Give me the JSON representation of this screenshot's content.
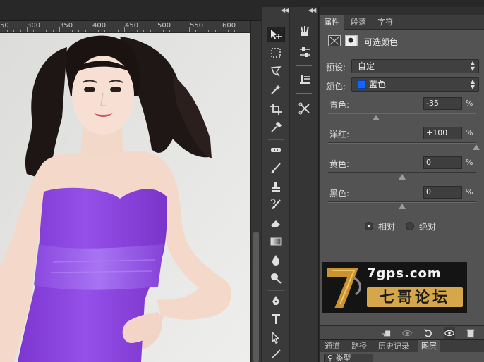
{
  "ruler": {
    "ticks": [
      "50",
      "300",
      "350",
      "400",
      "450",
      "500",
      "550",
      "600"
    ]
  },
  "panel": {
    "collapse_glyph": "◀◀",
    "tabs": [
      {
        "label": "属性",
        "active": true
      },
      {
        "label": "段落",
        "active": false
      },
      {
        "label": "字符",
        "active": false
      }
    ],
    "title": "可选颜色",
    "preset_label": "预设:",
    "preset_value": "自定",
    "color_label": "颜色:",
    "color_value": "蓝色",
    "color_swatch": "#1166ff",
    "sliders": [
      {
        "label": "青色:",
        "value": "-35",
        "unit": "%",
        "percent": -35
      },
      {
        "label": "洋红:",
        "value": "+100",
        "unit": "%",
        "percent": 100
      },
      {
        "label": "黄色:",
        "value": "0",
        "unit": "%",
        "percent": 0
      },
      {
        "label": "黑色:",
        "value": "0",
        "unit": "%",
        "percent": 0
      }
    ],
    "method": [
      {
        "label": "相对",
        "selected": true
      },
      {
        "label": "绝对",
        "selected": false
      }
    ],
    "logo": {
      "url": "7gps.com",
      "name": "七哥论坛"
    }
  },
  "layers": {
    "tabs": [
      {
        "label": "通道",
        "active": false
      },
      {
        "label": "路径",
        "active": false
      },
      {
        "label": "历史记录",
        "active": false
      },
      {
        "label": "图层",
        "active": true
      }
    ],
    "kind_filter": "类型"
  },
  "colors": {
    "panel_bg": "#535353",
    "dress": "#8a3fd8",
    "accent_swatch": "#1166ff"
  }
}
